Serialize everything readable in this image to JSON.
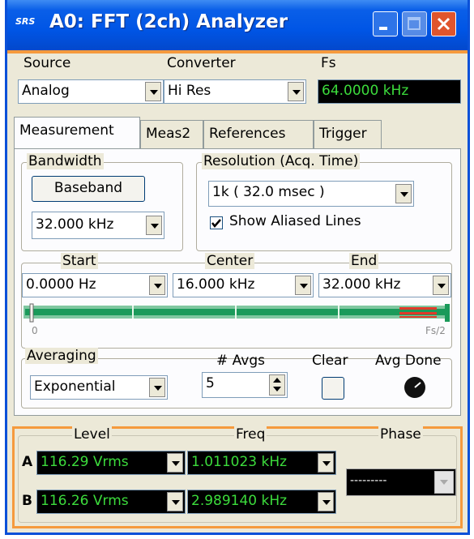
{
  "window": {
    "title": "A0: FFT (2ch) Analyzer",
    "logo": "SRS",
    "controls": [
      "minimize-icon",
      "maximize-icon",
      "close-icon"
    ]
  },
  "top": {
    "source_label": "Source",
    "source_value": "Analog",
    "converter_label": "Converter",
    "converter_value": "Hi Res",
    "fs_label": "Fs",
    "fs_value": "64.0000 kHz"
  },
  "tabs": [
    {
      "label": "Measurement",
      "active": true
    },
    {
      "label": "Meas2",
      "active": false
    },
    {
      "label": "References",
      "active": false
    },
    {
      "label": "Trigger",
      "active": false
    }
  ],
  "bandwidth": {
    "label": "Bandwidth",
    "button": "Baseband",
    "value": "32.000 kHz"
  },
  "resolution": {
    "label": "Resolution (Acq. Time)",
    "value": "1k   ( 32.0 msec )",
    "show_aliased_label": "Show Aliased Lines",
    "show_aliased_checked": true
  },
  "span": {
    "start_label": "Start",
    "start_value": "0.0000 Hz",
    "center_label": "Center",
    "center_value": "16.000 kHz",
    "end_label": "End",
    "end_value": "32.000 kHz",
    "scale_left": "0",
    "scale_right": "Fs/2"
  },
  "averaging": {
    "label": "Averaging",
    "mode": "Exponential",
    "navgs_label": "# Avgs",
    "navgs_value": "5",
    "clear_label": "Clear",
    "avgdone_label": "Avg Done"
  },
  "readout": {
    "level_label": "Level",
    "freq_label": "Freq",
    "phase_label": "Phase",
    "row_a": {
      "ch": "A",
      "level": "116.29 Vrms",
      "freq": "1.011023 kHz"
    },
    "row_b": {
      "ch": "B",
      "level": "116.26 Vrms",
      "freq": "2.989140 kHz"
    },
    "phase_value": "---------"
  },
  "colors": {
    "titlebar": "#0055e5",
    "accent_orange": "#f59a3d",
    "readout_green": "#3cdc3c",
    "span_bar_green": "#1a9a5a",
    "alias_red": "#e03a2a"
  }
}
